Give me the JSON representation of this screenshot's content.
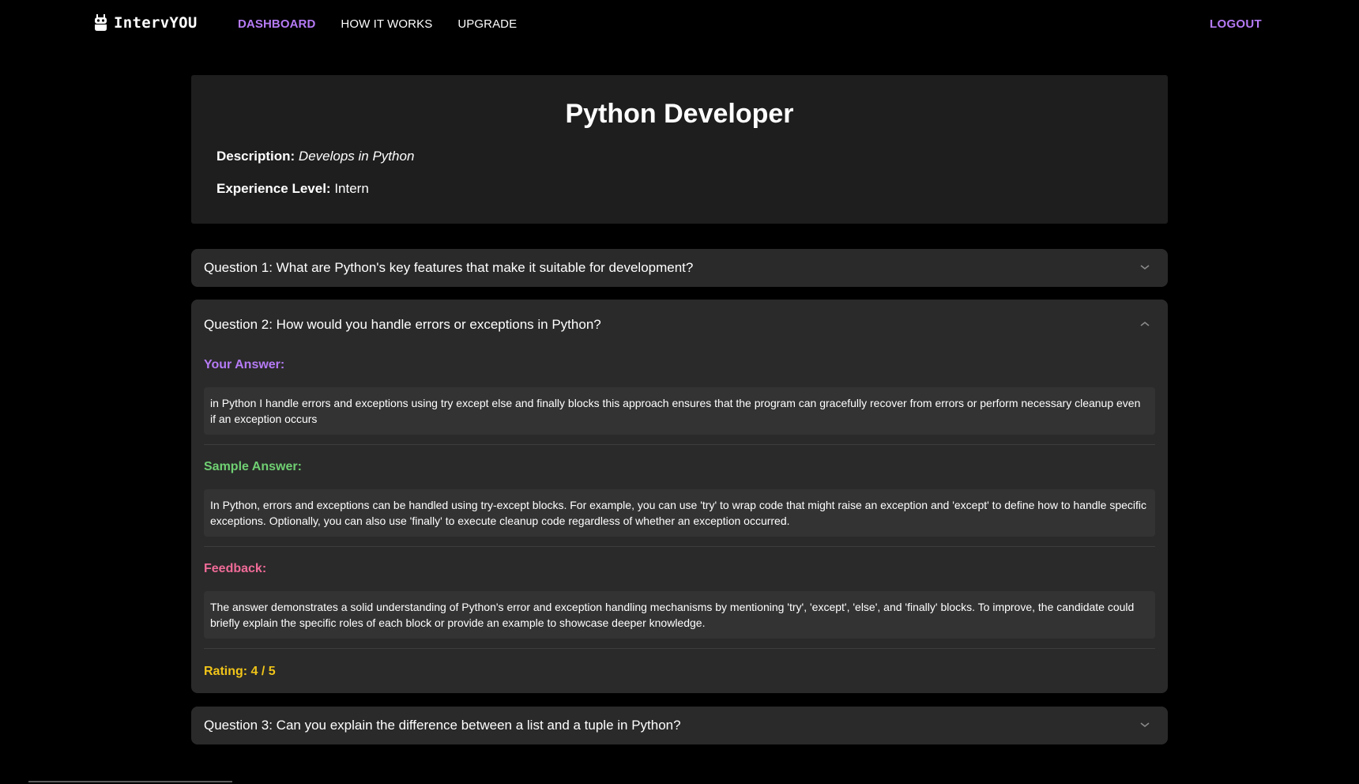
{
  "app": {
    "brand": "IntervYOU"
  },
  "nav": {
    "links": [
      {
        "label": "DASHBOARD",
        "active": true
      },
      {
        "label": "HOW IT WORKS",
        "active": false
      },
      {
        "label": "UPGRADE",
        "active": false
      }
    ],
    "logout": "LOGOUT"
  },
  "job": {
    "title": "Python Developer",
    "description_label": "Description:",
    "description": "Develops in Python",
    "experience_label": "Experience Level:",
    "experience": "Intern"
  },
  "questions": [
    {
      "title": "Question 1: What are Python's key features that make it suitable for development?",
      "expanded": false
    },
    {
      "title": "Question 2: How would you handle errors or exceptions in Python?",
      "expanded": true,
      "your_answer_label": "Your Answer:",
      "your_answer": "in Python I handle errors and exceptions using try except else and finally blocks this approach ensures that the program can gracefully recover from errors or perform necessary cleanup even if an exception occurs",
      "sample_answer_label": "Sample Answer:",
      "sample_answer": "In Python, errors and exceptions can be handled using try-except blocks. For example, you can use 'try' to wrap code that might raise an exception and 'except' to define how to handle specific exceptions. Optionally, you can also use 'finally' to execute cleanup code regardless of whether an exception occurred.",
      "feedback_label": "Feedback:",
      "feedback": "The answer demonstrates a solid understanding of Python's error and exception handling mechanisms by mentioning 'try', 'except', 'else', and 'finally' blocks. To improve, the candidate could briefly explain the specific roles of each block or provide an example to showcase deeper knowledge.",
      "rating": "Rating: 4 / 5"
    },
    {
      "title": "Question 3: Can you explain the difference between a list and a tuple in Python?",
      "expanded": false
    }
  ],
  "colors": {
    "accent": "#b57bf5",
    "sample": "#6fcf72",
    "feedback": "#ef6b97",
    "rating": "#f0c419",
    "card_bg": "#2a2a2a",
    "job_bg": "#1e1e1e"
  },
  "icons": {
    "brand": "robot-icon",
    "collapsed": "chevron-down-icon",
    "expanded": "chevron-up-icon"
  }
}
